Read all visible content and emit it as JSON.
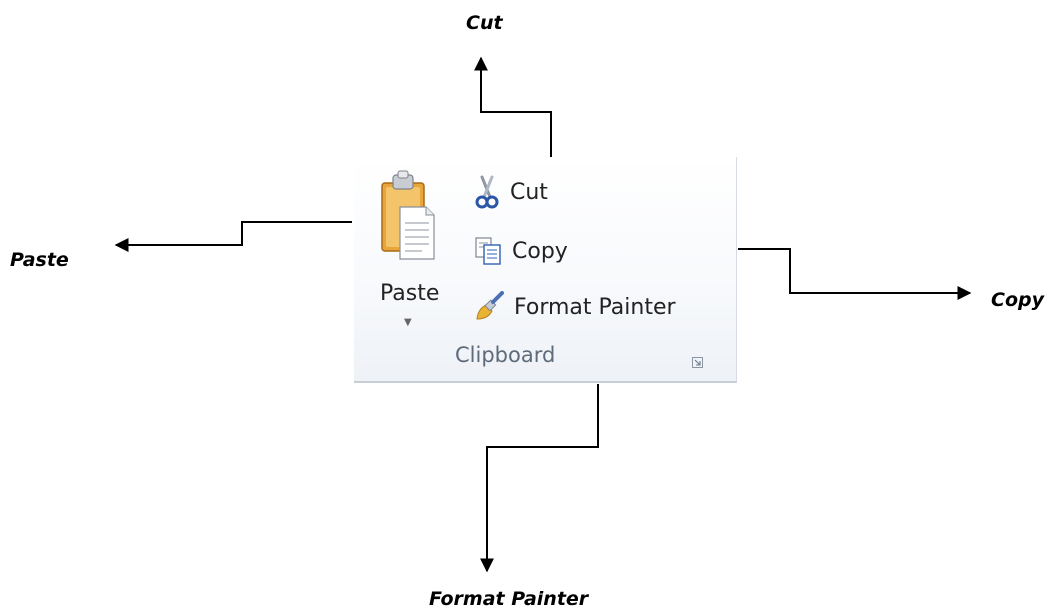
{
  "callouts": {
    "cut": "Cut",
    "paste": "Paste",
    "copy": "Copy",
    "format_painter": "Format Painter"
  },
  "clipboard_group": {
    "paste_label": "Paste",
    "cut_label": "Cut",
    "copy_label": "Copy",
    "format_painter_label": "Format Painter",
    "group_label": "Clipboard",
    "icons": [
      "clipboard-paste-icon",
      "scissors-icon",
      "copy-icon",
      "paintbrush-icon",
      "dropdown-arrow-icon",
      "dialog-launcher-icon"
    ]
  },
  "colors": {
    "panel_bg": "#f5f7fa",
    "group_label": "#5f6b7a",
    "clipboard_orange": "#e8a53a"
  }
}
